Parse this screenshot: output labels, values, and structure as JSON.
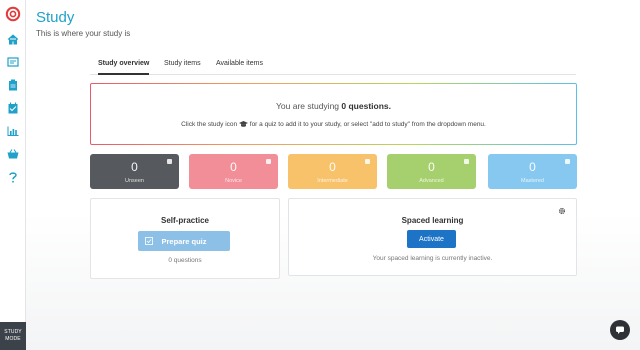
{
  "app": {
    "title": "Study",
    "subtitle": "This is where your study is",
    "study_mode_label_1": "STUDY",
    "study_mode_label_2": "MODE"
  },
  "sidebar": {
    "items": [
      {
        "icon": "home-icon",
        "active": true
      },
      {
        "icon": "flashcard-icon",
        "active": false
      },
      {
        "icon": "clipboard-icon",
        "active": false
      },
      {
        "icon": "calendar-icon",
        "active": false
      },
      {
        "icon": "chart-icon",
        "active": false
      },
      {
        "icon": "basket-icon",
        "active": false
      },
      {
        "icon": "help-icon",
        "active": false
      }
    ]
  },
  "tabs": [
    {
      "label": "Study overview",
      "active": true
    },
    {
      "label": "Study items",
      "active": false
    },
    {
      "label": "Available items",
      "active": false
    }
  ],
  "notice": {
    "prefix": "You are studying ",
    "count_text": "0 questions.",
    "line2_before": "Click the study icon ",
    "line2_after": " for a quiz to add it to your study, or select \"add to study\" from the dropdown menu."
  },
  "tiles": [
    {
      "count": "0",
      "label": "Unseen",
      "color": "#56595d"
    },
    {
      "count": "0",
      "label": "Novice",
      "color": "#f28e98"
    },
    {
      "count": "0",
      "label": "Intermediate",
      "color": "#f7c26a"
    },
    {
      "count": "0",
      "label": "Advanced",
      "color": "#a6d06d"
    },
    {
      "count": "0",
      "label": "Mastered",
      "color": "#86c8ef"
    }
  ],
  "self_practice": {
    "title": "Self-practice",
    "button": "Prepare quiz",
    "subtext": "0 questions"
  },
  "spaced_learning": {
    "title": "Spaced learning",
    "button": "Activate",
    "subtext": "Your spaced learning is currently inactive."
  },
  "colors": {
    "accent": "#1fa1c9",
    "primary_button": "#1d73c5",
    "disabled_button": "#8cc0e6",
    "logo": "#e23b3b"
  }
}
